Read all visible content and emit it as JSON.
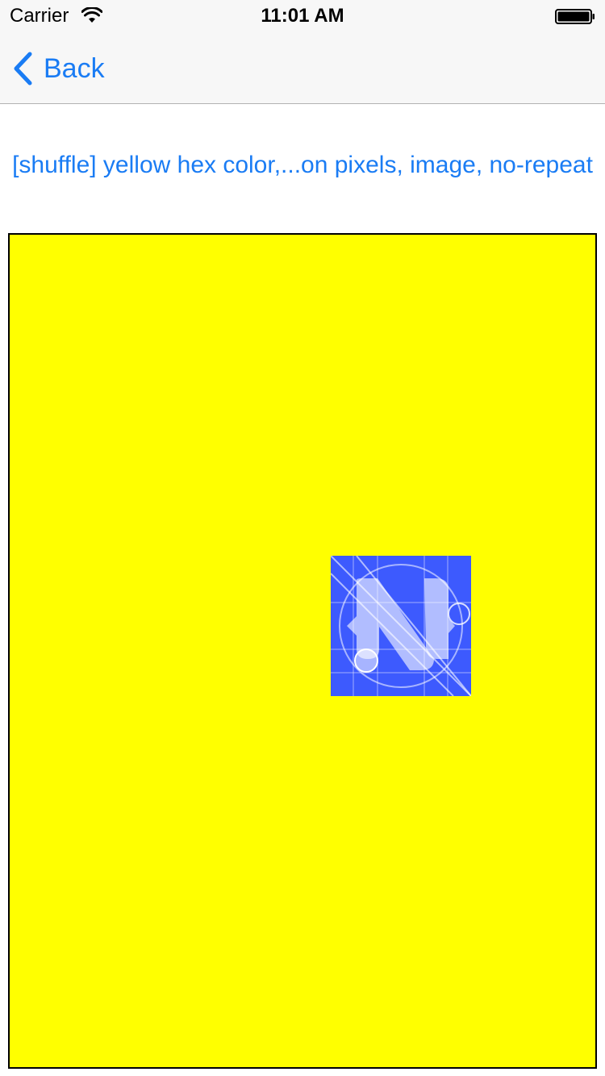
{
  "status_bar": {
    "carrier": "Carrier",
    "time": "11:01 AM",
    "icons": [
      "wifi-icon",
      "battery-icon"
    ]
  },
  "nav": {
    "back_label": "Back",
    "back_icon": "chevron-left-icon"
  },
  "content": {
    "shuffle_label": "[shuffle] yellow hex color,...on pixels, image, no-repeat",
    "preview_background_color": "#ffff00",
    "preview_image_icon": "nativescript-logo-icon",
    "preview_image_color": "#3d5afe"
  },
  "colors": {
    "accent": "#1a7cf4",
    "bar_background": "#f7f7f7"
  }
}
